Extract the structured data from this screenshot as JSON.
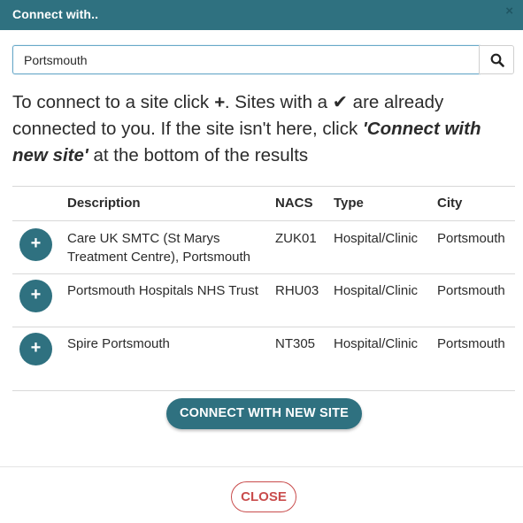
{
  "dialog": {
    "title": "Connect with..",
    "close_glyph": "×"
  },
  "search": {
    "value": "Portsmouth",
    "button_icon": "search-icon"
  },
  "instructions": {
    "part1": "To connect to a site click ",
    "plus": "+",
    "part2": ". Sites with a ",
    "check": "✔",
    "part3": " are already connected to you. If the site isn't here, click ",
    "connect_text": "'Connect with new site'",
    "part4": " at the bottom of the results"
  },
  "table": {
    "columns": [
      "Description",
      "NACS",
      "Type",
      "City"
    ],
    "rows": [
      {
        "description": "Care UK SMTC (St Marys Treatment Centre), Portsmouth",
        "nacs": "ZUK01",
        "type": "Hospital/Clinic",
        "city": "Portsmouth"
      },
      {
        "description": "Portsmouth Hospitals NHS Trust",
        "nacs": "RHU03",
        "type": "Hospital/Clinic",
        "city": "Portsmouth"
      },
      {
        "description": "Spire Portsmouth",
        "nacs": "NT305",
        "type": "Hospital/Clinic",
        "city": "Portsmouth"
      }
    ],
    "add_glyph": "+"
  },
  "buttons": {
    "connect_new": "CONNECT WITH NEW SITE",
    "close": "CLOSE"
  },
  "colors": {
    "accent": "#2f7180",
    "close_red": "#c94c4c"
  }
}
